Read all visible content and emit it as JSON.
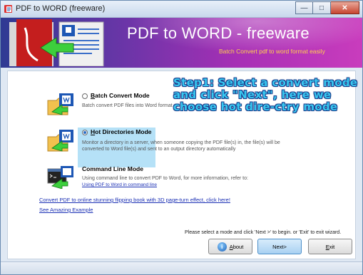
{
  "window": {
    "title": "PDF to WORD (freeware)"
  },
  "banner": {
    "heading": "PDF to WORD - freeware",
    "subtitle": "Batch Convert pdf to word format easily"
  },
  "modes": [
    {
      "title_prefix": "",
      "title_access": "B",
      "title_rest": "atch Convert Mode",
      "desc": "Batch convert PDF files into Word format",
      "selected": false,
      "icon": "folder-word-icon"
    },
    {
      "title_prefix": "",
      "title_access": "H",
      "title_rest": "ot Directories Mode",
      "desc": "Monitor a directory in a server, when someone copying the PDF file(s) in, the file(s) will be converted to Word file(s) and sent to an output directory automatically",
      "selected": true,
      "icon": "folder-word-icon"
    },
    {
      "title_prefix": "",
      "title_access": "",
      "title_rest": "Command Line Mode",
      "desc_prefix": "Using command line to convert PDF to Word, for more information, refer to:",
      "desc_link": "Using PDF to Word in command line",
      "selected": false,
      "icon": "cmd-word-icon"
    }
  ],
  "links": {
    "flipbook": "Convert PDF to online stunning flipping book with 3D page-turn effect, click here!",
    "example": "See Amazing Example"
  },
  "step_note": "Step1: Select a convert mode and click \"Next\", here we choose hot dire-ctry mode",
  "instruction": "Please select a mode and click 'Next >' to begin. or 'Exit' to exit wizard.",
  "buttons": {
    "about_access": "A",
    "about_rest": "bout",
    "next": "Next>",
    "exit_access": "E",
    "exit_rest": "xit"
  },
  "colors": {
    "banner_start": "#2f3a93",
    "banner_end": "#c93cbd",
    "link": "#1a2fb4",
    "step_note": "#38c8f0",
    "highlight": "#78c8f0"
  }
}
